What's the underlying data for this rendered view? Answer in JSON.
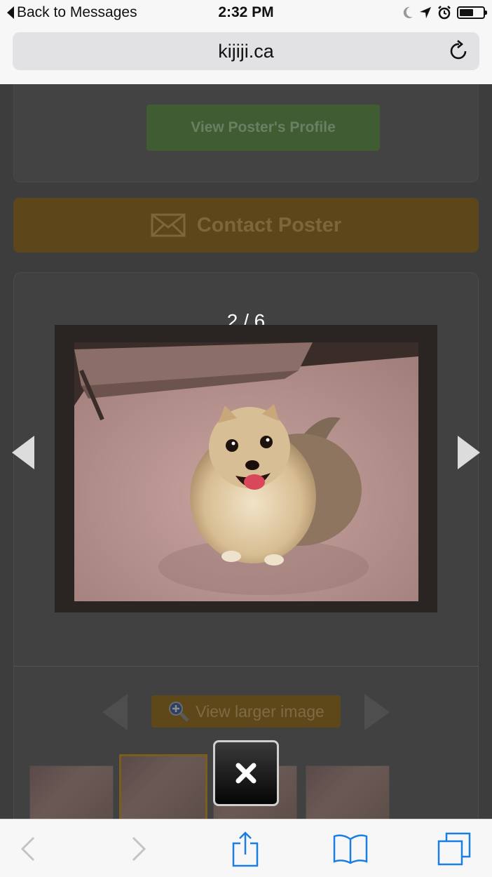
{
  "status_bar": {
    "back_label": "Back to Messages",
    "time": "2:32 PM",
    "battery_level": 0.6
  },
  "browser": {
    "url": "kijiji.ca"
  },
  "listing": {
    "profile_button": "View Poster's Profile",
    "contact_button": "Contact Poster",
    "view_larger": "View larger image"
  },
  "lightbox": {
    "counter": "2 / 6",
    "current_index": 2,
    "total": 6
  },
  "icons": {
    "back": "back-triangle-icon",
    "moon": "moon-icon",
    "location": "location-arrow-icon",
    "alarm": "alarm-icon",
    "battery": "battery-icon",
    "reload": "reload-icon",
    "envelope": "envelope-icon",
    "magnifier": "zoom-icon",
    "close": "close-icon",
    "share": "share-icon",
    "bookmarks": "book-icon",
    "tabs": "tabs-icon"
  },
  "colors": {
    "safari_blue": "#1a7fe0",
    "disabled_gray": "#c4c4c4",
    "contact_orange_dimmed": "#5e461b",
    "profile_green_dimmed": "#3f5c33"
  }
}
